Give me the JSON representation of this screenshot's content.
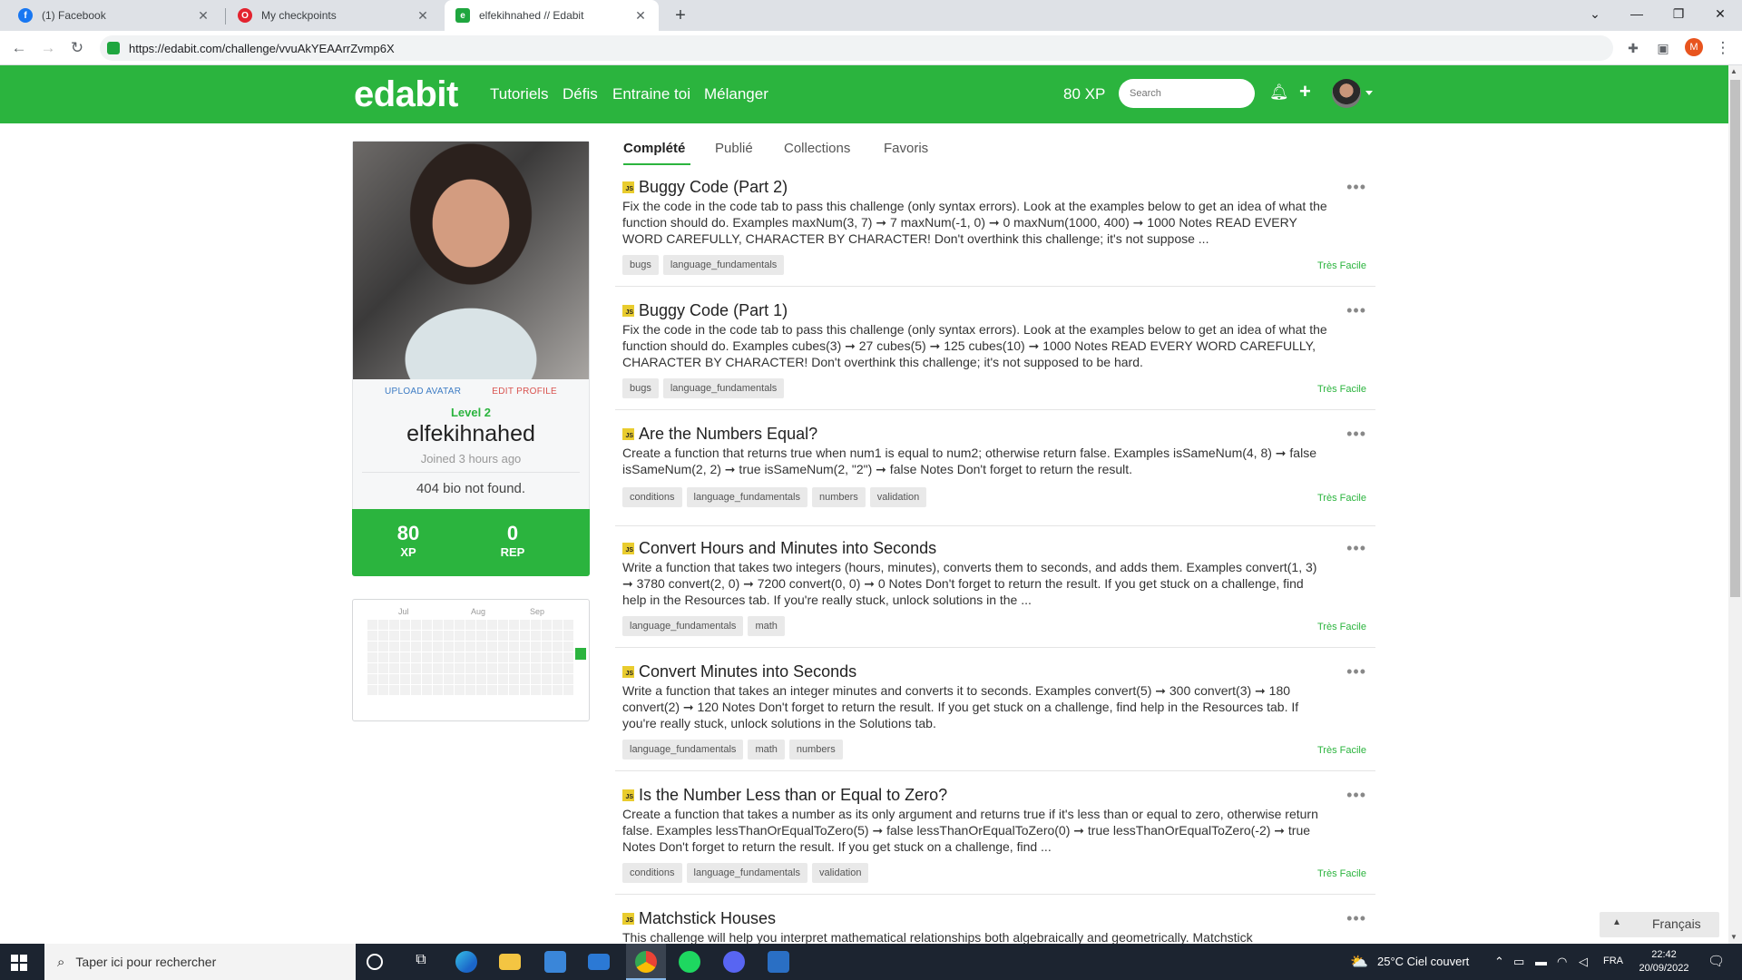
{
  "browser": {
    "tabs": [
      {
        "title": "(1) Facebook",
        "icon": "facebook-icon",
        "color": "#1877f2"
      },
      {
        "title": "My checkpoints",
        "icon": "opera-icon",
        "color": "#e3232f"
      },
      {
        "title": "elfekihnahed // Edabit",
        "icon": "edabit-icon",
        "color": "#1fa63f"
      }
    ],
    "url": "https://edabit.com/challenge/vvuAkYEAArrZvmp6X",
    "profile_initial": "M"
  },
  "nav": {
    "logo": "edabit",
    "links": [
      "Tutoriels",
      "Défis",
      "Entraine toi",
      "Mélanger"
    ],
    "xp": "80 XP",
    "search_placeholder": "Search"
  },
  "profile": {
    "upload_avatar": "UPLOAD AVATAR",
    "edit_profile": "EDIT PROFILE",
    "level": "Level 2",
    "username": "elfekihnahed",
    "joined": "Joined 3 hours ago",
    "bio": "404 bio not found.",
    "xp_value": "80",
    "xp_label": "XP",
    "rep_value": "0",
    "rep_label": "REP"
  },
  "heatmap": {
    "months": [
      "Jul",
      "Aug",
      "Sep"
    ]
  },
  "subtabs": [
    "Complété",
    "Publié",
    "Collections",
    "Favoris"
  ],
  "challenges": [
    {
      "title": "Buggy Code (Part 2)",
      "desc": "Fix the code in the code tab to pass this challenge (only syntax errors). Look at the examples below to get an idea of what the function should do. Examples maxNum(3, 7) ➞ 7 maxNum(-1, 0) ➞ 0 maxNum(1000, 400) ➞ 1000 Notes READ EVERY WORD CAREFULLY, CHARACTER BY CHARACTER! Don't overthink this challenge; it's not suppose ...",
      "tags": [
        "bugs",
        "language_fundamentals"
      ],
      "difficulty": "Très Facile"
    },
    {
      "title": "Buggy Code (Part 1)",
      "desc": "Fix the code in the code tab to pass this challenge (only syntax errors). Look at the examples below to get an idea of what the function should do. Examples cubes(3) ➞ 27 cubes(5) ➞ 125 cubes(10) ➞ 1000 Notes READ EVERY WORD CAREFULLY, CHARACTER BY CHARACTER! Don't overthink this challenge; it's not supposed to be hard.",
      "tags": [
        "bugs",
        "language_fundamentals"
      ],
      "difficulty": "Très Facile"
    },
    {
      "title": "Are the Numbers Equal?",
      "desc": "Create a function that returns true when num1 is equal to num2; otherwise return false. Examples isSameNum(4, 8) ➞ false isSameNum(2, 2) ➞ true isSameNum(2, \"2\") ➞ false Notes Don't forget to return the result.",
      "tags": [
        "conditions",
        "language_fundamentals",
        "numbers",
        "validation"
      ],
      "difficulty": "Très Facile"
    },
    {
      "title": "Convert Hours and Minutes into Seconds",
      "desc": "Write a function that takes two integers (hours, minutes), converts them to seconds, and adds them. Examples convert(1, 3) ➞ 3780 convert(2, 0) ➞ 7200 convert(0, 0) ➞ 0 Notes Don't forget to return the result. If you get stuck on a challenge, find help in the Resources tab. If you're really stuck, unlock solutions in the ...",
      "tags": [
        "language_fundamentals",
        "math"
      ],
      "difficulty": "Très Facile"
    },
    {
      "title": "Convert Minutes into Seconds",
      "desc": "Write a function that takes an integer minutes and converts it to seconds. Examples convert(5) ➞ 300 convert(3) ➞ 180 convert(2) ➞ 120 Notes Don't forget to return the result. If you get stuck on a challenge, find help in the Resources tab. If you're really stuck, unlock solutions in the Solutions tab.",
      "tags": [
        "language_fundamentals",
        "math",
        "numbers"
      ],
      "difficulty": "Très Facile"
    },
    {
      "title": "Is the Number Less than or Equal to Zero?",
      "desc": "Create a function that takes a number as its only argument and returns true if it's less than or equal to zero, otherwise return false. Examples lessThanOrEqualToZero(5) ➞ false lessThanOrEqualToZero(0) ➞ true lessThanOrEqualToZero(-2) ➞ true Notes Don't forget to return the result. If you get stuck on a challenge, find ...",
      "tags": [
        "conditions",
        "language_fundamentals",
        "validation"
      ],
      "difficulty": "Très Facile"
    },
    {
      "title": "Matchstick Houses",
      "desc": "This challenge will help you interpret mathematical relationships both algebraically and geometrically. Matchstick",
      "tags": [],
      "difficulty": ""
    }
  ],
  "js_badge": "JS",
  "language_button": "Français",
  "taskbar": {
    "search_placeholder": "Taper ici pour rechercher",
    "weather": "25°C  Ciel couvert",
    "lang": "FRA",
    "time": "22:42",
    "date": "20/09/2022"
  },
  "colors": {
    "brand": "#2bb43e",
    "tag_bg": "#e9e9e9",
    "js_badge": "#e9cc2e"
  }
}
